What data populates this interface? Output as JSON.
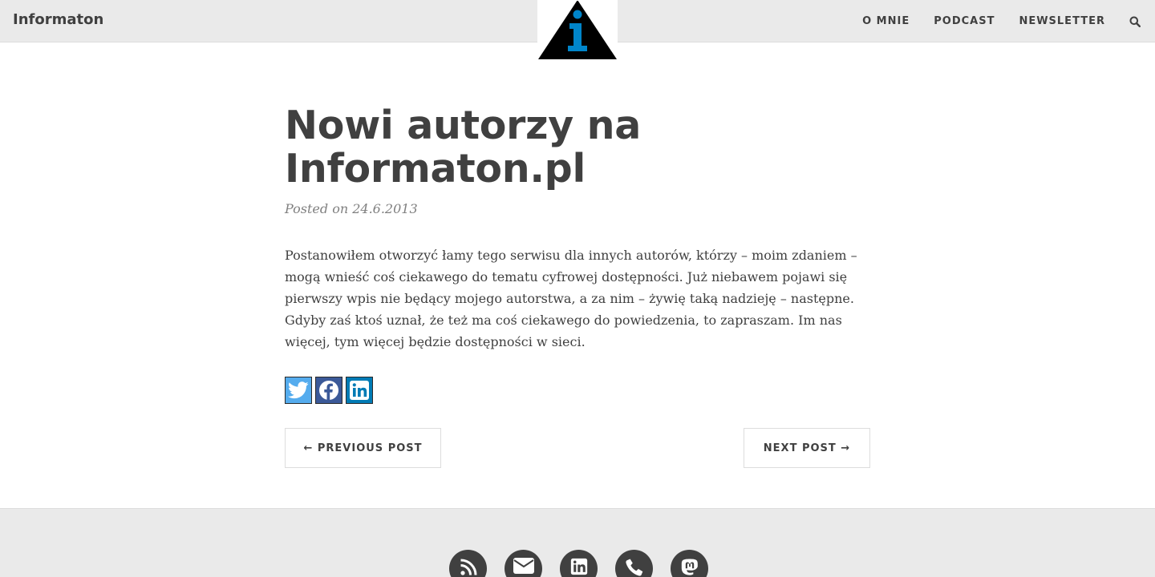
{
  "navbar": {
    "brand": "Informaton",
    "links": [
      "O MNIE",
      "PODCAST",
      "NEWSLETTER"
    ],
    "search_icon": "search-icon",
    "logo_icon": "info-triangle-logo"
  },
  "post": {
    "title": "Nowi autorzy na Informaton.pl",
    "meta_prefix": "Posted on",
    "date": "24.6.2013",
    "body": "Postanowiłem otworzyć łamy tego serwisu dla innych autorów, którzy – moim zdaniem – mogą wnieść coś ciekawego do tematu cyfrowej dostępności. Już niebawem pojawi się pierwszy wpis nie będący mojego autorstwa, a za nim – żywię taką nadzieję – następne. Gdyby zaś ktoś uznał, że też ma coś ciekawego do powiedzenia, to zapraszam. Im nas więcej, tym więcej będzie dostępności w sieci."
  },
  "share": {
    "icons": [
      "twitter-icon",
      "facebook-icon",
      "linkedin-icon"
    ]
  },
  "pager": {
    "prev_label": "← PREVIOUS POST",
    "next_label": "NEXT POST →"
  },
  "footer": {
    "icons": [
      "rss-icon",
      "email-icon",
      "linkedin-icon",
      "phone-icon",
      "mastodon-icon"
    ]
  },
  "colors": {
    "navbar_bg": "#eaeaea",
    "text": "#404040",
    "meta": "#808080",
    "logo_accent": "#0085ca",
    "twitter": "#55acee",
    "facebook": "#3b5998",
    "linkedin": "#007bb5"
  }
}
